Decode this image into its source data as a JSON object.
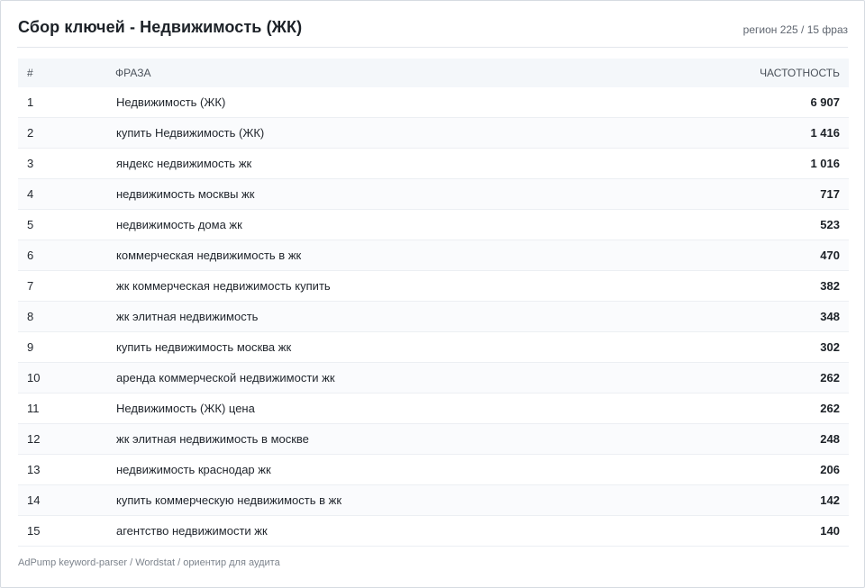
{
  "header": {
    "title": "Сбор ключей - Недвижимость (ЖК)",
    "meta": "регион 225 / 15 фраз"
  },
  "table": {
    "columns": [
      "#",
      "Фраза",
      "Частотность"
    ],
    "rows": [
      {
        "idx": "1",
        "phrase": "Недвижимость (ЖК)",
        "freq": "6 907"
      },
      {
        "idx": "2",
        "phrase": "купить Недвижимость (ЖК)",
        "freq": "1 416"
      },
      {
        "idx": "3",
        "phrase": "яндекс недвижимость жк",
        "freq": "1 016"
      },
      {
        "idx": "4",
        "phrase": "недвижимость москвы жк",
        "freq": "717"
      },
      {
        "idx": "5",
        "phrase": "недвижимость дома жк",
        "freq": "523"
      },
      {
        "idx": "6",
        "phrase": "коммерческая недвижимость в жк",
        "freq": "470"
      },
      {
        "idx": "7",
        "phrase": "жк коммерческая недвижимость купить",
        "freq": "382"
      },
      {
        "idx": "8",
        "phrase": "жк элитная недвижимость",
        "freq": "348"
      },
      {
        "idx": "9",
        "phrase": "купить недвижимость москва жк",
        "freq": "302"
      },
      {
        "idx": "10",
        "phrase": "аренда коммерческой недвижимости жк",
        "freq": "262"
      },
      {
        "idx": "11",
        "phrase": "Недвижимость (ЖК) цена",
        "freq": "262"
      },
      {
        "idx": "12",
        "phrase": "жк элитная недвижимость в москве",
        "freq": "248"
      },
      {
        "idx": "13",
        "phrase": "недвижимость краснодар жк",
        "freq": "206"
      },
      {
        "idx": "14",
        "phrase": "купить коммерческую недвижимость в жк",
        "freq": "142"
      },
      {
        "idx": "15",
        "phrase": "агентство недвижимости жк",
        "freq": "140"
      }
    ]
  },
  "footer": {
    "text": "AdPump keyword-parser / Wordstat / ориентир для аудита"
  }
}
